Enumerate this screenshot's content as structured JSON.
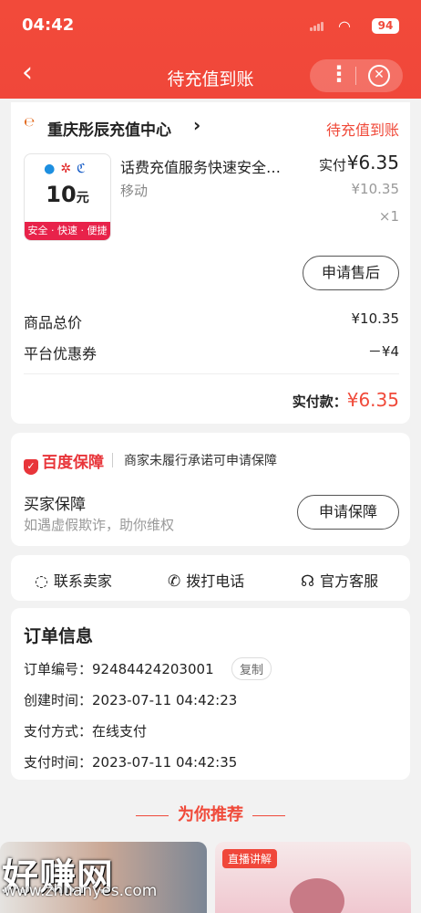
{
  "status_bar": {
    "time": "04:42",
    "battery": "94"
  },
  "nav": {
    "title": "待充值到账",
    "more_icon": "more-dots-icon",
    "close_icon": "close-circle-icon"
  },
  "order_card": {
    "store_name": "重庆彤辰充值中心",
    "status": "待充值到账",
    "thumb_ops": [
      "●",
      "✲",
      "ℭ"
    ],
    "thumb_amount": "10",
    "thumb_unit": "元",
    "thumb_ribbon": "安全 · 快速 · 便捷",
    "product_title": "话费充值服务快速安全…",
    "product_spec": "移动",
    "paid_label": "实付",
    "paid_value": "¥6.35",
    "original_price": "¥10.35",
    "quantity": "×1",
    "after_sale_button": "申请售后",
    "goods_total_label": "商品总价",
    "goods_total_value": "¥10.35",
    "coupon_label": "平台优惠券",
    "coupon_value": "－¥4",
    "total_label": "实付款：",
    "total_value": "¥6.35"
  },
  "guarantee": {
    "logo_text": "百度保障",
    "note": "商家未履行承诺可申请保障",
    "title": "买家保障",
    "subtitle": "如遇虚假欺诈，助你维权",
    "button": "申请保障"
  },
  "actions": [
    {
      "label": "联系卖家",
      "icon": "chat-icon"
    },
    {
      "label": "拨打电话",
      "icon": "phone-icon"
    },
    {
      "label": "官方客服",
      "icon": "headset-icon"
    }
  ],
  "order_info": {
    "title": "订单信息",
    "number": "订单编号：92484424203001",
    "copy": "复制",
    "created": "创建时间：2023-07-11 04:42:23",
    "payment_method": "支付方式：在线支付",
    "paid_time": "支付时间：2023-07-11 04:42:35"
  },
  "recommend": {
    "title": "为你推荐",
    "live_badge": "直播讲解"
  },
  "watermark": {
    "text": "好赚网",
    "url": "www.zhuanyes.com"
  }
}
